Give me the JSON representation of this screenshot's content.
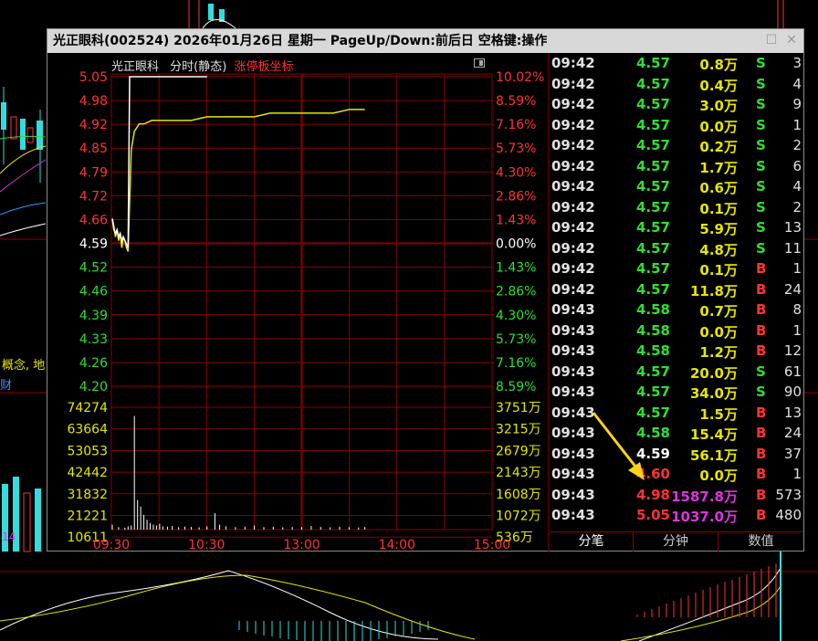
{
  "window": {
    "title": "光正眼科(002524) 2026年01月26日 星期一 PageUp/Down:前后日 空格键:操作"
  },
  "chart_header": {
    "name": "光正眼科",
    "mode": "分时(静态)",
    "limit_axis": "涨停板坐标"
  },
  "background": {
    "label_concept": "概念, 地",
    "label_cai": "财",
    "label_14": "14"
  },
  "colors": {
    "up": "#ff3333",
    "down": "#33dd33",
    "neutral": "#ffffff",
    "volume": "#e6e600",
    "grid": "#8b0000",
    "large_buy": "#dd33dd"
  },
  "chart_data": {
    "type": "line",
    "price_axis": {
      "ticks": [
        "5.05",
        "4.98",
        "4.92",
        "4.85",
        "4.79",
        "4.72",
        "4.66",
        "4.59",
        "4.52",
        "4.46",
        "4.39",
        "4.33",
        "4.26",
        "4.20"
      ],
      "ylim": [
        4.2,
        5.05
      ],
      "prev_close": 4.59
    },
    "pct_axis": {
      "ticks": [
        "10.02%",
        "8.59%",
        "7.16%",
        "5.73%",
        "4.30%",
        "2.86%",
        "1.43%",
        "0.00%",
        "1.43%",
        "2.86%",
        "4.30%",
        "5.73%",
        "7.16%",
        "8.59%"
      ]
    },
    "volume_axis": {
      "left_ticks": [
        "74274",
        "63664",
        "53053",
        "42442",
        "31832",
        "21221",
        "10611"
      ],
      "right_ticks": [
        "3751万",
        "3215万",
        "2679万",
        "2143万",
        "1608万",
        "1072万",
        "536万"
      ]
    },
    "time_axis": {
      "ticks": [
        "09:30",
        "10:30",
        "13:00",
        "14:00",
        "15:00"
      ],
      "total_minutes": 240
    },
    "series": [
      {
        "x": [
          0,
          1,
          2,
          3,
          4,
          5,
          6,
          7,
          8,
          9,
          10,
          12,
          14,
          17,
          20,
          25,
          30,
          40,
          50,
          60,
          70,
          80,
          90,
          100,
          110,
          120,
          130,
          140,
          150,
          160
        ],
        "y": [
          4.66,
          4.64,
          4.61,
          4.63,
          4.6,
          4.62,
          4.58,
          4.61,
          4.6,
          4.58,
          4.57,
          4.85,
          4.9,
          4.92,
          4.92,
          4.93,
          4.93,
          4.93,
          4.93,
          4.94,
          4.94,
          4.94,
          4.94,
          4.95,
          4.95,
          4.95,
          4.95,
          4.95,
          4.96,
          4.96
        ]
      },
      {
        "x": [
          0,
          1,
          2,
          3,
          4,
          5,
          6,
          7,
          8,
          9,
          10,
          11
        ],
        "y": [
          4.66,
          4.63,
          4.62,
          4.63,
          4.61,
          4.62,
          4.6,
          4.61,
          4.6,
          4.59,
          4.58,
          5.05
        ]
      }
    ],
    "volume": [
      {
        "x": 0,
        "v": 3000
      },
      {
        "x": 4,
        "v": 1500
      },
      {
        "x": 8,
        "v": 1200
      },
      {
        "x": 10,
        "v": 2000
      },
      {
        "x": 12,
        "v": 2500
      },
      {
        "x": 14,
        "v": 69000
      },
      {
        "x": 16,
        "v": 18000
      },
      {
        "x": 18,
        "v": 14000
      },
      {
        "x": 20,
        "v": 9000
      },
      {
        "x": 22,
        "v": 6000
      },
      {
        "x": 24,
        "v": 4000
      },
      {
        "x": 26,
        "v": 3000
      },
      {
        "x": 28,
        "v": 2500
      },
      {
        "x": 30,
        "v": 3500
      },
      {
        "x": 32,
        "v": 2000
      },
      {
        "x": 35,
        "v": 1800
      },
      {
        "x": 38,
        "v": 2200
      },
      {
        "x": 42,
        "v": 1500
      },
      {
        "x": 46,
        "v": 1800
      },
      {
        "x": 50,
        "v": 1600
      },
      {
        "x": 55,
        "v": 1400
      },
      {
        "x": 60,
        "v": 2000
      },
      {
        "x": 65,
        "v": 10000
      },
      {
        "x": 68,
        "v": 3000
      },
      {
        "x": 72,
        "v": 2000
      },
      {
        "x": 78,
        "v": 1500
      },
      {
        "x": 84,
        "v": 1800
      },
      {
        "x": 90,
        "v": 2500
      },
      {
        "x": 96,
        "v": 1500
      },
      {
        "x": 102,
        "v": 1800
      },
      {
        "x": 108,
        "v": 1400
      },
      {
        "x": 114,
        "v": 1600
      },
      {
        "x": 120,
        "v": 1500
      },
      {
        "x": 126,
        "v": 2200
      },
      {
        "x": 132,
        "v": 1600
      },
      {
        "x": 138,
        "v": 1400
      },
      {
        "x": 144,
        "v": 1700
      },
      {
        "x": 150,
        "v": 1500
      },
      {
        "x": 156,
        "v": 1300
      },
      {
        "x": 160,
        "v": 1600
      }
    ]
  },
  "trades": [
    {
      "time": "09:42",
      "price": "4.57",
      "vol": "0.8万",
      "side": "S",
      "count": "3"
    },
    {
      "time": "09:42",
      "price": "4.57",
      "vol": "0.4万",
      "side": "S",
      "count": "4"
    },
    {
      "time": "09:42",
      "price": "4.57",
      "vol": "3.0万",
      "side": "S",
      "count": "9"
    },
    {
      "time": "09:42",
      "price": "4.57",
      "vol": "0.0万",
      "side": "S",
      "count": "1"
    },
    {
      "time": "09:42",
      "price": "4.57",
      "vol": "0.2万",
      "side": "S",
      "count": "2"
    },
    {
      "time": "09:42",
      "price": "4.57",
      "vol": "1.7万",
      "side": "S",
      "count": "6"
    },
    {
      "time": "09:42",
      "price": "4.57",
      "vol": "0.6万",
      "side": "S",
      "count": "4"
    },
    {
      "time": "09:42",
      "price": "4.57",
      "vol": "0.1万",
      "side": "S",
      "count": "2"
    },
    {
      "time": "09:42",
      "price": "4.57",
      "vol": "5.9万",
      "side": "S",
      "count": "13"
    },
    {
      "time": "09:42",
      "price": "4.57",
      "vol": "4.8万",
      "side": "S",
      "count": "11"
    },
    {
      "time": "09:42",
      "price": "4.57",
      "vol": "0.1万",
      "side": "B",
      "count": "1"
    },
    {
      "time": "09:42",
      "price": "4.57",
      "vol": "11.8万",
      "side": "B",
      "count": "24"
    },
    {
      "time": "09:43",
      "price": "4.58",
      "vol": "0.7万",
      "side": "B",
      "count": "8"
    },
    {
      "time": "09:43",
      "price": "4.58",
      "vol": "0.0万",
      "side": "B",
      "count": "1"
    },
    {
      "time": "09:43",
      "price": "4.58",
      "vol": "1.2万",
      "side": "B",
      "count": "12"
    },
    {
      "time": "09:43",
      "price": "4.57",
      "vol": "20.0万",
      "side": "S",
      "count": "61"
    },
    {
      "time": "09:43",
      "price": "4.57",
      "vol": "34.0万",
      "side": "S",
      "count": "90"
    },
    {
      "time": "09:43",
      "price": "4.57",
      "vol": "1.5万",
      "side": "B",
      "count": "13"
    },
    {
      "time": "09:43",
      "price": "4.58",
      "vol": "15.4万",
      "side": "B",
      "count": "24"
    },
    {
      "time": "09:43",
      "price": "4.59",
      "vol": "56.1万",
      "side": "B",
      "count": "37"
    },
    {
      "time": "09:43",
      "price": "4.60",
      "vol": "0.0万",
      "side": "B",
      "count": "1"
    },
    {
      "time": "09:43",
      "price": "4.98",
      "vol": "1587.8万",
      "side": "B",
      "count": "573"
    },
    {
      "time": "09:43",
      "price": "5.05",
      "vol": "1037.0万",
      "side": "B",
      "count": "480"
    }
  ],
  "tabs": [
    {
      "label": "分笔",
      "active": true
    },
    {
      "label": "分钟",
      "active": false
    },
    {
      "label": "数值",
      "active": false
    }
  ]
}
